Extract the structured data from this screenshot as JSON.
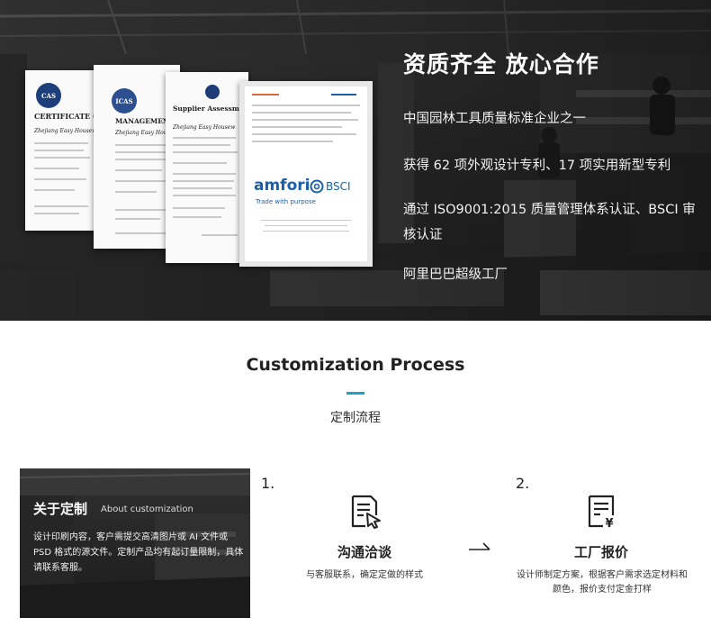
{
  "hero": {
    "title": "资质齐全 放心合作",
    "lines": [
      "中国园林工具质量标准企业之一",
      "获得 62 项外观设计专利、17 项实用新型专利",
      "通过 ISO9001:2015 质量管理体系认证、BSCI 审核认证",
      "阿里巴巴超级工厂"
    ],
    "certificates": [
      {
        "heading": "CERTIFICATE OF I",
        "seal": "CAS",
        "company": "Zhejiang Easy Housew"
      },
      {
        "heading": "MANAGEMENT S",
        "seal": "ICAS",
        "company": "Zhejiang Easy Hous"
      },
      {
        "heading": "Supplier Assessm",
        "company": "Zhejiang Easy Housew"
      },
      {
        "brand": "amfori",
        "brand_sub": "BSCI",
        "tagline": "Trade with purpose"
      }
    ]
  },
  "process": {
    "title": "Customization Process",
    "subtitle": "定制流程"
  },
  "about": {
    "title": "关于定制",
    "title_en": "About customization",
    "desc": "设计印刷内容，客户需提交高清图片或 AI 文件或 PSD 格式的源文件。定制产品均有起订量限制，具体请联系客服。"
  },
  "steps": [
    {
      "num": "1.",
      "title": "沟通洽谈",
      "desc": "与客服联系，确定定做的样式",
      "icon": "document-edit-icon"
    },
    {
      "num": "2.",
      "title": "工厂报价",
      "desc": "设计师制定方案，根据客户需求选定材料和颜色，报价支付定金打样",
      "icon": "document-price-icon"
    }
  ],
  "colors": {
    "accent": "#1fa0c8",
    "amfori_blue": "#1a5fa8"
  }
}
